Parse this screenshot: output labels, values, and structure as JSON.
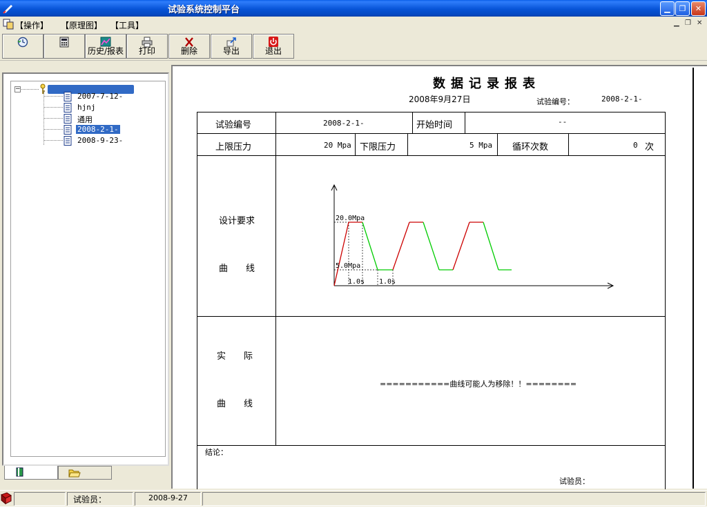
{
  "window": {
    "title": "试验系统控制平台"
  },
  "menu": {
    "items": [
      "【操作】",
      "【原理图】",
      "【工具】"
    ]
  },
  "toolbar": {
    "buttons": [
      {
        "label": "",
        "icon": "clock-icon"
      },
      {
        "label": "",
        "icon": "calculator-icon"
      },
      {
        "label": "历史/报表",
        "icon": "chart-icon"
      },
      {
        "label": "打印",
        "icon": "printer-icon"
      },
      {
        "label": "删除",
        "icon": "delete-icon"
      },
      {
        "label": "导出",
        "icon": "export-icon"
      },
      {
        "label": "退出",
        "icon": "power-icon"
      }
    ]
  },
  "tree": {
    "items": [
      {
        "label": "2007-7-12-"
      },
      {
        "label": "hjnj"
      },
      {
        "label": "通用"
      },
      {
        "label": "2008-2-1-",
        "selected": true
      },
      {
        "label": "2008-9-23-"
      }
    ]
  },
  "report": {
    "title": "数据记录报表",
    "date": "2008年9月27日",
    "number_label": "试验编号：",
    "number_value": "2008-2-1-",
    "row1": {
      "test_no_label": "试验编号",
      "test_no_value": "2008-2-1-",
      "start_time_label": "开始时间",
      "start_time_value": "--"
    },
    "row2": {
      "upper_label": "上限压力",
      "upper_value": "20 Mpa",
      "lower_label": "下限压力",
      "lower_value": "5 Mpa",
      "cycles_label": "循环次数",
      "cycles_value": "0",
      "cycles_unit": "次"
    },
    "design_label_1": "设计要求",
    "design_label_2": "曲　　线",
    "actual_label_1": "实　　际",
    "actual_label_2": "曲　　线",
    "actual_message": "===========曲线可能人为移除！！========",
    "conclusion_label": "结论：",
    "tester_label": "试验员："
  },
  "chart_data": {
    "type": "line",
    "upper_label": "20.0Mpa",
    "lower_label": "5.0Mpa",
    "time_label_1": "1.0s",
    "time_label_2": "1.0s",
    "upper": 20.0,
    "lower": 5.0,
    "colors": {
      "rise": "#cc0000",
      "fall": "#00cc00"
    }
  },
  "statusbar": {
    "tester_label": "试验员：",
    "date": "2008-9-27"
  }
}
